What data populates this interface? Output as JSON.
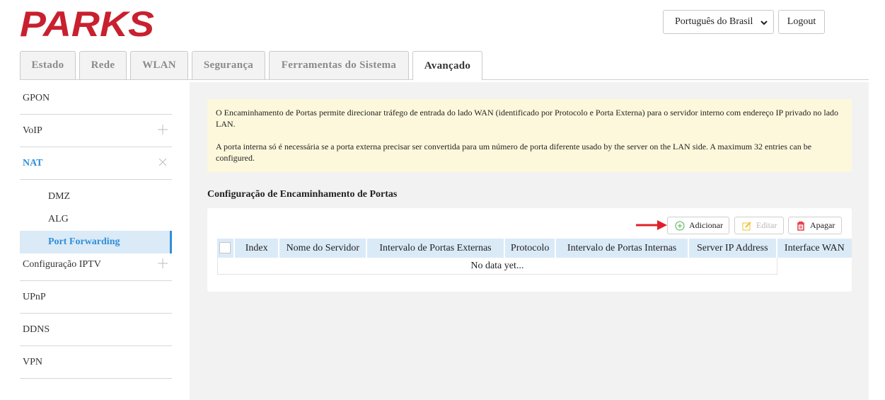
{
  "header": {
    "brand": "PARKS",
    "language": "Português do Brasil",
    "logout_label": "Logout"
  },
  "tabs": [
    {
      "label": "Estado"
    },
    {
      "label": "Rede"
    },
    {
      "label": "WLAN"
    },
    {
      "label": "Segurança"
    },
    {
      "label": "Ferramentas do Sistema"
    },
    {
      "label": "Avançado",
      "active": true
    }
  ],
  "sidebar": {
    "items": [
      {
        "label": "GPON"
      },
      {
        "label": "VoIP",
        "icon": "plus-icon"
      },
      {
        "label": "NAT",
        "icon": "close-icon",
        "active": true
      },
      {
        "label": "Configuração IPTV",
        "icon": "plus-icon"
      },
      {
        "label": "UPnP"
      },
      {
        "label": "DDNS"
      },
      {
        "label": "VPN"
      }
    ],
    "nat_sub": [
      {
        "label": "DMZ"
      },
      {
        "label": "ALG"
      },
      {
        "label": "Port Forwarding",
        "active": true
      }
    ]
  },
  "notice": {
    "line1": "O Encaminhamento de Portas permite direcionar tráfego de entrada do lado WAN (identificado por Protocolo e Porta Externa) para o servidor interno com endereço IP privado no lado LAN.",
    "line2": "A porta interna só é necessária se a porta externa precisar ser convertida para um número de porta diferente usado by the server on the LAN side. A maximum 32 entries can be configured."
  },
  "section_title": "Configuração de Encaminhamento de Portas",
  "toolbar": {
    "add_label": "Adicionar",
    "edit_label": "Editar",
    "delete_label": "Apagar"
  },
  "table": {
    "headers": [
      "Index",
      "Nome do Servidor",
      "Intervalo de Portas Externas",
      "Protocolo",
      "Intervalo de Portas Internas",
      "Server IP Address",
      "Interface WAN"
    ],
    "empty_text": "No data yet..."
  },
  "colors": {
    "brand_red": "#c8202f",
    "accent_blue": "#2f8fd9",
    "notice_bg": "#fdf8dc",
    "header_row_bg": "#dbeaf7"
  }
}
